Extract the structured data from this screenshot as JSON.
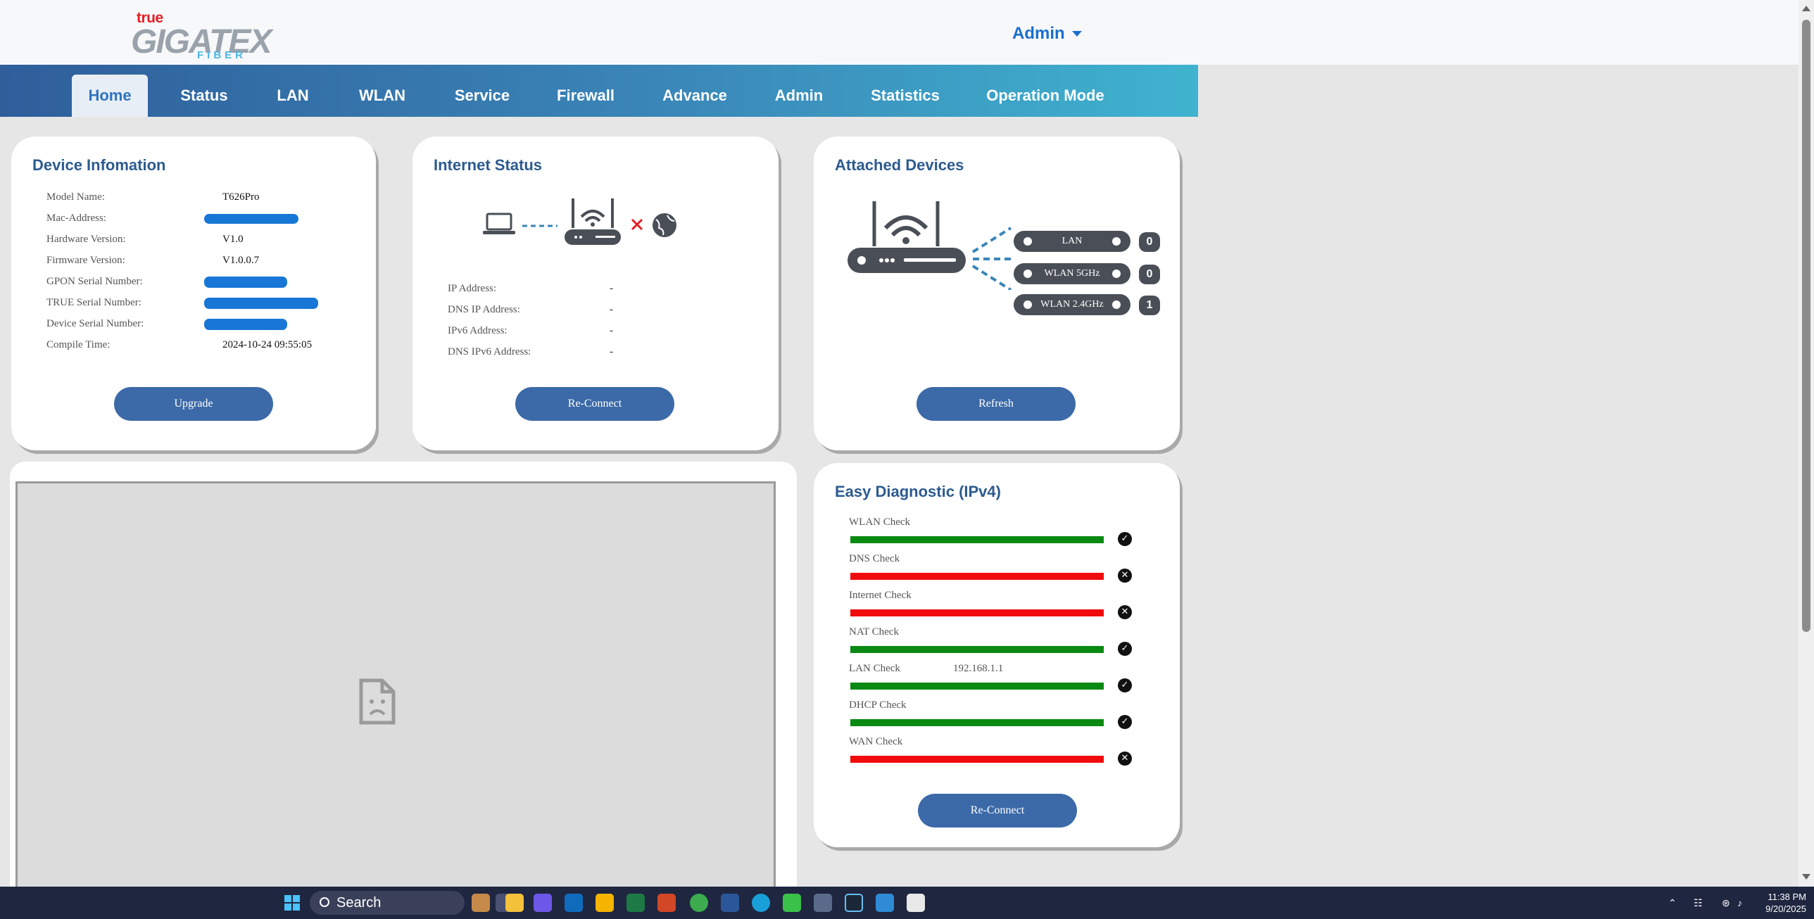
{
  "header": {
    "logo_true": "true",
    "logo_main": "GIGATEX",
    "logo_sub": "FIBER",
    "user_menu": "Admin"
  },
  "nav": [
    {
      "label": "Home",
      "active": true
    },
    {
      "label": "Status"
    },
    {
      "label": "LAN"
    },
    {
      "label": "WLAN"
    },
    {
      "label": "Service"
    },
    {
      "label": "Firewall"
    },
    {
      "label": "Advance"
    },
    {
      "label": "Admin"
    },
    {
      "label": "Statistics"
    },
    {
      "label": "Operation Mode"
    }
  ],
  "device_info": {
    "title": "Device Infomation",
    "rows": [
      {
        "label": "Model Name:",
        "value": "T626Pro"
      },
      {
        "label": "Mac-Address:",
        "value": ""
      },
      {
        "label": "Hardware Version:",
        "value": "V1.0"
      },
      {
        "label": "Firmware Version:",
        "value": "V1.0.0.7"
      },
      {
        "label": "GPON Serial Number:",
        "value": ""
      },
      {
        "label": "TRUE Serial Number:",
        "value": ""
      },
      {
        "label": "Device Serial Number:",
        "value": ""
      },
      {
        "label": "Compile Time:",
        "value": "2024-10-24 09:55:05"
      }
    ],
    "button": "Upgrade"
  },
  "internet_status": {
    "title": "Internet Status",
    "rows": [
      {
        "label": "IP Address:",
        "value": "-"
      },
      {
        "label": "DNS IP Address:",
        "value": "-"
      },
      {
        "label": "IPv6 Address:",
        "value": "-"
      },
      {
        "label": "DNS IPv6 Address:",
        "value": "-"
      }
    ],
    "button": "Re-Connect"
  },
  "attached_devices": {
    "title": "Attached Devices",
    "items": [
      {
        "label": "LAN",
        "count": "0"
      },
      {
        "label": "WLAN 5GHz",
        "count": "0"
      },
      {
        "label": "WLAN 2.4GHz",
        "count": "1"
      }
    ],
    "button": "Refresh"
  },
  "diagnostic": {
    "title": "Easy Diagnostic (IPv4)",
    "checks": [
      {
        "label": "WLAN Check",
        "value": "",
        "status": "pass"
      },
      {
        "label": "DNS Check",
        "value": "",
        "status": "fail"
      },
      {
        "label": "Internet Check",
        "value": "",
        "status": "fail"
      },
      {
        "label": "NAT Check",
        "value": "",
        "status": "pass"
      },
      {
        "label": "LAN Check",
        "value": "192.168.1.1",
        "status": "pass"
      },
      {
        "label": "DHCP Check",
        "value": "",
        "status": "pass"
      },
      {
        "label": "WAN Check",
        "value": "",
        "status": "fail"
      }
    ],
    "button": "Re-Connect"
  },
  "colors": {
    "pass": "#0a8a12",
    "fail": "#f00c0c",
    "button": "#3c6aa8",
    "title": "#2c5b8f"
  },
  "taskbar": {
    "search": "Search",
    "time": "11:38 PM",
    "date": "9/20/2025"
  }
}
